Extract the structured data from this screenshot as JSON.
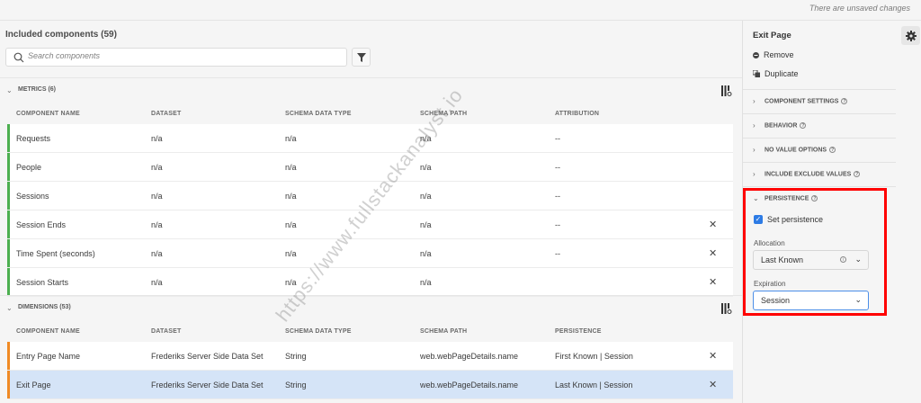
{
  "topbar": {
    "status": "There are unsaved changes"
  },
  "components": {
    "title": "Included components (59)",
    "search_placeholder": "Search components",
    "metrics": {
      "label": "METRICS (6)",
      "columns": [
        "COMPONENT NAME",
        "DATASET",
        "SCHEMA DATA TYPE",
        "SCHEMA PATH",
        "ATTRIBUTION"
      ],
      "rows": [
        {
          "name": "Requests",
          "dataset": "n/a",
          "type": "n/a",
          "path": "n/a",
          "attr": "--",
          "removable": false
        },
        {
          "name": "People",
          "dataset": "n/a",
          "type": "n/a",
          "path": "n/a",
          "attr": "--",
          "removable": false
        },
        {
          "name": "Sessions",
          "dataset": "n/a",
          "type": "n/a",
          "path": "n/a",
          "attr": "--",
          "removable": false
        },
        {
          "name": "Session Ends",
          "dataset": "n/a",
          "type": "n/a",
          "path": "n/a",
          "attr": "--",
          "removable": true
        },
        {
          "name": "Time Spent (seconds)",
          "dataset": "n/a",
          "type": "n/a",
          "path": "n/a",
          "attr": "--",
          "removable": true
        },
        {
          "name": "Session Starts",
          "dataset": "n/a",
          "type": "n/a",
          "path": "n/a",
          "attr": "",
          "removable": true
        }
      ]
    },
    "dimensions": {
      "label": "DIMENSIONS (53)",
      "columns": [
        "COMPONENT NAME",
        "DATASET",
        "SCHEMA DATA TYPE",
        "SCHEMA PATH",
        "PERSISTENCE"
      ],
      "rows": [
        {
          "name": "Entry Page Name",
          "dataset": "Frederiks Server Side Data Set",
          "type": "String",
          "path": "web.webPageDetails.name",
          "attr": "First Known | Session",
          "removable": true
        },
        {
          "name": "Exit Page",
          "dataset": "Frederiks Server Side Data Set",
          "type": "String",
          "path": "web.webPageDetails.name",
          "attr": "Last Known | Session",
          "removable": true,
          "selected": true
        }
      ]
    },
    "colors": {
      "metric": "#4caf50",
      "dimension": "#f08a24",
      "selected": "#d5e4f7"
    }
  },
  "panel": {
    "title": "Exit Page",
    "remove": "Remove",
    "duplicate": "Duplicate",
    "sections": [
      "COMPONENT SETTINGS",
      "BEHAVIOR",
      "NO VALUE OPTIONS",
      "INCLUDE EXCLUDE VALUES"
    ],
    "persistence": {
      "label": "PERSISTENCE",
      "set_label": "Set persistence",
      "set_checked": true,
      "allocation_label": "Allocation",
      "allocation_value": "Last Known",
      "expiration_label": "Expiration",
      "expiration_value": "Session"
    }
  },
  "watermark": "https://www.fullstackanalyst.io"
}
